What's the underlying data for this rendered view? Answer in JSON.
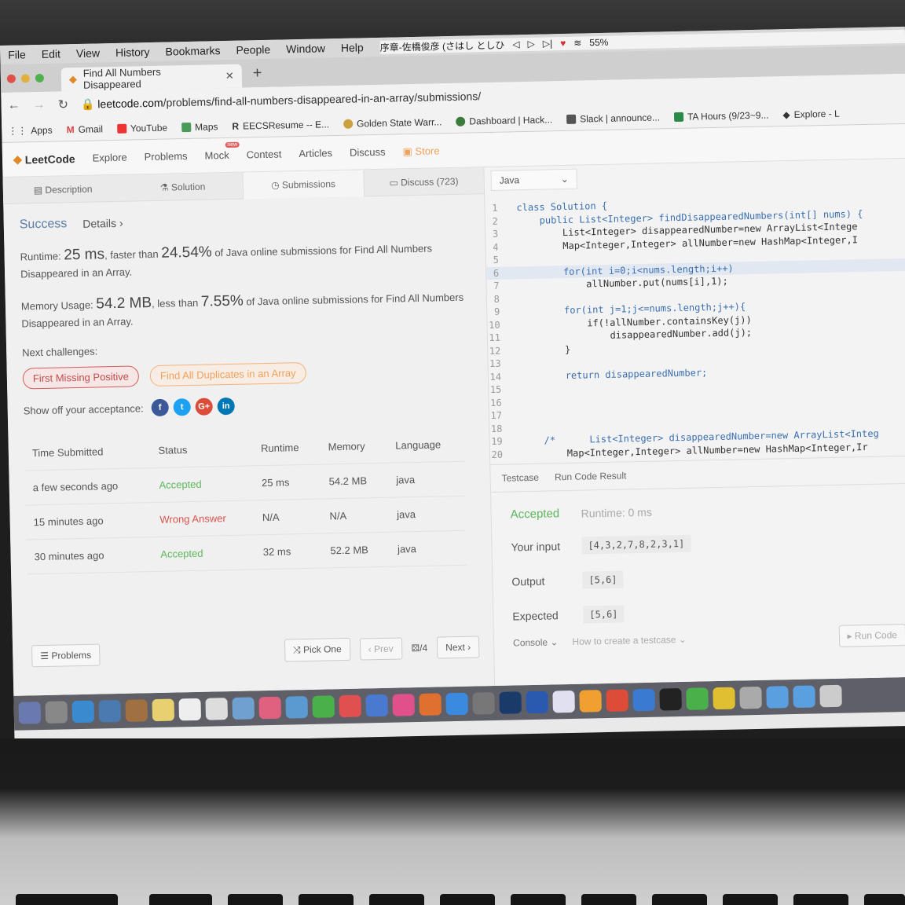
{
  "menubar": {
    "items": [
      "File",
      "Edit",
      "View",
      "History",
      "Bookmarks",
      "People",
      "Window",
      "Help"
    ],
    "status": "序章-佐橋俊彦 (さはし としひ",
    "battery": "55%"
  },
  "browser": {
    "tab_title": "Find All Numbers Disappeared",
    "url_host": "leetcode.com",
    "url_path": "/problems/find-all-numbers-disappeared-in-an-array/submissions/",
    "bookmarks": [
      "Apps",
      "Gmail",
      "YouTube",
      "Maps",
      "EECSResume -- E...",
      "Golden State Warr...",
      "Dashboard | Hack...",
      "Slack | announce...",
      "TA Hours (9/23~9...",
      "Explore - L"
    ]
  },
  "lc_nav": {
    "logo": "LeetCode",
    "items": [
      "Explore",
      "Problems",
      "Mock",
      "Contest",
      "Articles",
      "Discuss",
      "Store"
    ],
    "mock_badge": "new"
  },
  "left_tabs": [
    "Description",
    "Solution",
    "Submissions",
    "Discuss (723)"
  ],
  "result": {
    "success": "Success",
    "details": "Details ›",
    "runtime_label": "Runtime:",
    "runtime": "25 ms",
    "runtime_mid": ", faster than",
    "runtime_pct": "24.54%",
    "runtime_tail": "of Java online submissions for Find All Numbers Disappeared in an Array.",
    "memory_label": "Memory Usage:",
    "memory": "54.2 MB",
    "memory_mid": ", less than",
    "memory_pct": "7.55%",
    "memory_tail": "of Java online submissions for Find All Numbers Disappeared in an Array.",
    "next_challenges": "Next challenges:",
    "challenge1": "First Missing Positive",
    "challenge2": "Find All Duplicates in an Array",
    "share_label": "Show off your acceptance:"
  },
  "submissions": {
    "headers": [
      "Time Submitted",
      "Status",
      "Runtime",
      "Memory",
      "Language"
    ],
    "rows": [
      [
        "a few seconds ago",
        "Accepted",
        "25 ms",
        "54.2 MB",
        "java"
      ],
      [
        "15 minutes ago",
        "Wrong Answer",
        "N/A",
        "N/A",
        "java"
      ],
      [
        "30 minutes ago",
        "Accepted",
        "32 ms",
        "52.2 MB",
        "java"
      ]
    ]
  },
  "left_bottom": {
    "problems": "Problems",
    "pick_one": "Pick One",
    "prev": "‹ Prev",
    "page": "/4",
    "next": "Next ›"
  },
  "editor": {
    "language": "Java",
    "lines": [
      "class Solution {",
      "    public List<Integer> findDisappearedNumbers(int[] nums) {",
      "        List<Integer> disappearedNumber=new ArrayList<Intege",
      "        Map<Integer,Integer> allNumber=new HashMap<Integer,I",
      "",
      "        for(int i=0;i<nums.length;i++)",
      "            allNumber.put(nums[i],1);",
      "",
      "        for(int j=1;j<=nums.length;j++){",
      "            if(!allNumber.containsKey(j))",
      "                disappearedNumber.add(j);",
      "        }",
      "",
      "        return disappearedNumber;",
      "",
      "",
      "",
      "",
      "    /*      List<Integer> disappearedNumber=new ArrayList<Integ",
      "        Map<Integer,Integer> allNumber=new HashMap<Integer,Ir"
    ]
  },
  "run_result": {
    "tabs": [
      "Testcase",
      "Run Code Result"
    ],
    "status": "Accepted",
    "runtime": "Runtime: 0 ms",
    "input_label": "Your input",
    "input": "[4,3,2,7,8,2,3,1]",
    "output_label": "Output",
    "output": "[5,6]",
    "expected_label": "Expected",
    "expected": "[5,6]"
  },
  "right_bottom": {
    "console": "Console ⌄",
    "how_to": "How to create a testcase ⌄",
    "run_code": "▸ Run Code"
  },
  "colors": {
    "accepted": "#5cb85c",
    "wrong": "#d9534f",
    "keyword": "#3a6fb0"
  }
}
